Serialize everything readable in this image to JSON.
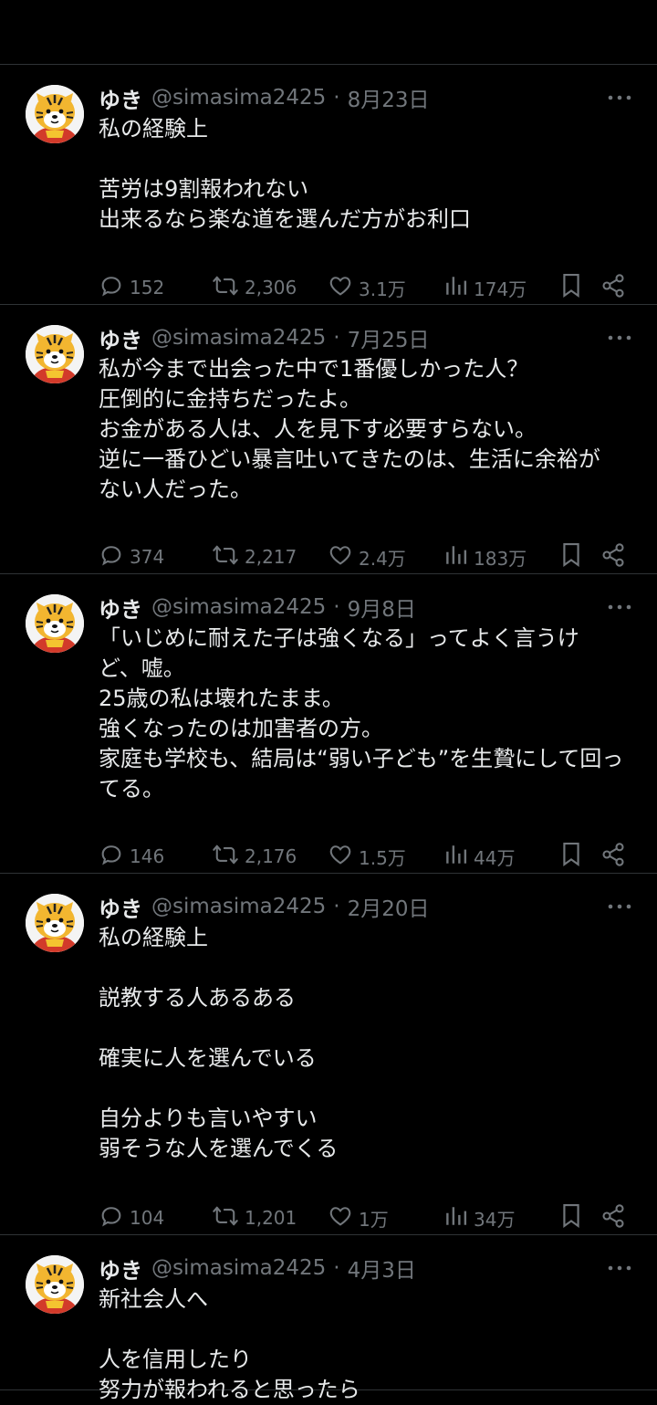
{
  "colors": {
    "background": "#000000",
    "text": "#e7e9ea",
    "muted": "#71767b",
    "divider": "#2f3336"
  },
  "tweets": [
    {
      "name": "ゆき",
      "handle": "@simasima2425",
      "sep": "·",
      "date": "8月23日",
      "text": "私の経験上\n\n苦労は9割報われない\n出来るなら楽な道を選んだ方がお利口",
      "replies": "152",
      "retweets": "2,306",
      "likes": "3.1万",
      "views": "174万"
    },
    {
      "name": "ゆき",
      "handle": "@simasima2425",
      "sep": "·",
      "date": "7月25日",
      "text": "私が今まで出会った中で1番優しかった人？\n圧倒的に金持ちだったよ。\nお金がある人は、人を見下す必要すらない。\n逆に一番ひどい暴言吐いてきたのは、生活に余裕が\nない人だった。",
      "replies": "374",
      "retweets": "2,217",
      "likes": "2.4万",
      "views": "183万"
    },
    {
      "name": "ゆき",
      "handle": "@simasima2425",
      "sep": "·",
      "date": "9月8日",
      "text": "「いじめに耐えた子は強くなる」ってよく言うけ\nど、嘘。\n25歳の私は壊れたまま。\n強くなったのは加害者の方。\n家庭も学校も、結局は“弱い子ども”を生贄にして回っ\nてる。",
      "replies": "146",
      "retweets": "2,176",
      "likes": "1.5万",
      "views": "44万"
    },
    {
      "name": "ゆき",
      "handle": "@simasima2425",
      "sep": "·",
      "date": "2月20日",
      "text": "私の経験上\n\n説教する人あるある\n\n確実に人を選んでいる\n\n自分よりも言いやすい\n弱そうな人を選んでくる",
      "replies": "104",
      "retweets": "1,201",
      "likes": "1万",
      "views": "34万"
    },
    {
      "name": "ゆき",
      "handle": "@simasima2425",
      "sep": "·",
      "date": "4月3日",
      "text": "新社会人へ\n\n人を信用したり\n努力が報われると思ったら",
      "replies": "",
      "retweets": "",
      "likes": "",
      "views": ""
    }
  ]
}
